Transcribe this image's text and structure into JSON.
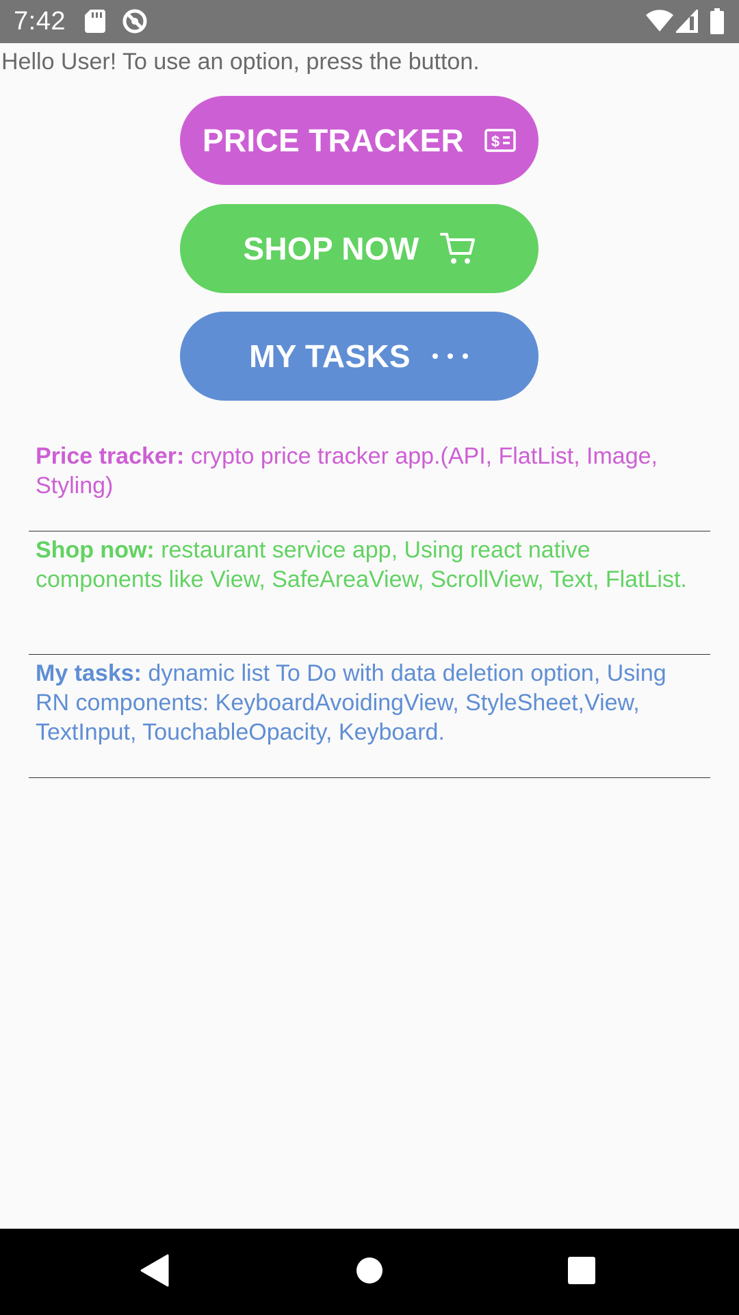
{
  "status_bar": {
    "time": "7:42",
    "icons": [
      "sd-card-icon",
      "sync-icon",
      "wifi-icon",
      "signal-icon",
      "battery-icon"
    ]
  },
  "greeting": "Hello User! To use an option, press the button.",
  "buttons": [
    {
      "label": "PRICE TRACKER",
      "icon": "price-tag-icon",
      "color": "#cd5fd4"
    },
    {
      "label": "SHOP NOW",
      "icon": "cart-icon",
      "color": "#62d262"
    },
    {
      "label": "MY TASKS",
      "icon": "more-dots-icon",
      "color": "#5f8ed4"
    }
  ],
  "descriptions": [
    {
      "title": "Price tracker:",
      "text": " crypto price tracker app.(API, FlatList, Image, Styling)",
      "color": "#cd5fd4"
    },
    {
      "title": "Shop now:",
      "text": " restaurant service app, Using react native components like View, SafeAreaView, ScrollView, Text, FlatList.",
      "color": "#62d262"
    },
    {
      "title": "My tasks:",
      "text": " dynamic list To Do with data deletion option, Using RN components: KeyboardAvoidingView, StyleSheet,View, TextInput, TouchableOpacity, Keyboard.",
      "color": "#5f8ed4"
    }
  ],
  "nav_bar": {
    "buttons": [
      "back-icon",
      "home-icon",
      "recents-icon"
    ]
  }
}
